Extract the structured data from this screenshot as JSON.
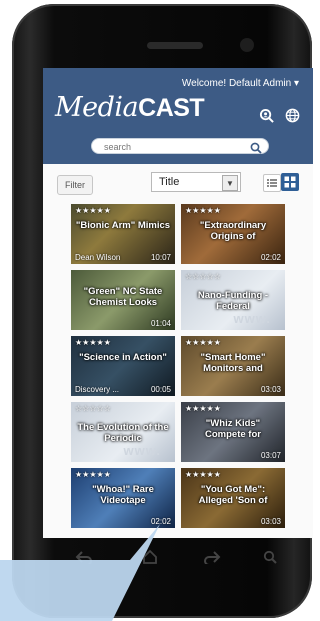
{
  "header": {
    "welcome": "Welcome! Default Admin ▾",
    "logo_media": "Media",
    "logo_cast": "CAST",
    "icons": [
      "user-search-icon",
      "globe-icon"
    ]
  },
  "search": {
    "placeholder": "search"
  },
  "toolbar": {
    "filter_label": "Filter",
    "sort_value": "Title",
    "view_modes": [
      "list-view-icon",
      "grid-view-icon"
    ]
  },
  "videos": [
    {
      "title": "\"Bionic Arm\" Mimics",
      "stars": "★★★★★",
      "meta": "Dean Wilson",
      "duration": "10:07",
      "bg": "linear-gradient(135deg,#4b4b2f,#8e7a3d 40%,#2a2418)"
    },
    {
      "title": "\"Extraordinary Origins of",
      "stars": "★★★★★",
      "meta": "",
      "duration": "02:02",
      "bg": "linear-gradient(135deg,#5a3a1e,#a06b3a 45%,#3a2410)"
    },
    {
      "title": "\"Green\" NC State Chemist Looks",
      "stars": "",
      "meta": "",
      "duration": "01:04",
      "bg": "linear-gradient(135deg,#4c5a3a,#8b9a6a 50%,#2e3a22)"
    },
    {
      "title": "Nano-Funding - Federal",
      "stars": "☆☆☆☆☆",
      "meta": "",
      "duration": "",
      "bg": "linear-gradient(135deg,#c7cfd9,#e8edf2 60%,#b7c1ce)",
      "plain": true
    },
    {
      "title": "\"Science in Action\"",
      "stars": "★★★★★",
      "meta": "Discovery ...",
      "duration": "00:05",
      "bg": "linear-gradient(135deg,#1f2f3e,#365064 50%,#101a22)"
    },
    {
      "title": "\"Smart Home\" Monitors and",
      "stars": "★★★★★",
      "meta": "",
      "duration": "03:03",
      "bg": "linear-gradient(135deg,#5e4a2c,#9a7d4e 50%,#3a2c18)"
    },
    {
      "title": "The Evolution of the Periodic",
      "stars": "☆☆☆☆☆",
      "meta": "",
      "duration": "",
      "bg": "linear-gradient(135deg,#c7cfd9,#e8edf2 60%,#b7c1ce)",
      "plain": true
    },
    {
      "title": "\"Whiz Kids\" Compete for",
      "stars": "★★★★★",
      "meta": "",
      "duration": "03:07",
      "bg": "linear-gradient(135deg,#3a3f48,#6d7480 50%,#20242a)"
    },
    {
      "title": "\"Whoa!\" Rare Videotape",
      "stars": "★★★★★",
      "meta": "",
      "duration": "02:02",
      "bg": "linear-gradient(135deg,#1d3e70,#4f7fb8 50%,#0f2446)"
    },
    {
      "title": "\"You Got Me\": Alleged 'Son of",
      "stars": "★★★★★",
      "meta": "",
      "duration": "03:03",
      "bg": "linear-gradient(135deg,#4a3418,#8a6a34 50%,#2c1e0c)"
    }
  ],
  "nav": [
    "back-icon",
    "home-icon",
    "recent-apps-icon",
    "search-icon"
  ],
  "colors": {
    "accent": "#3d5b85",
    "grid_active": "#2f5f96",
    "callout": "#bcd6ee"
  }
}
